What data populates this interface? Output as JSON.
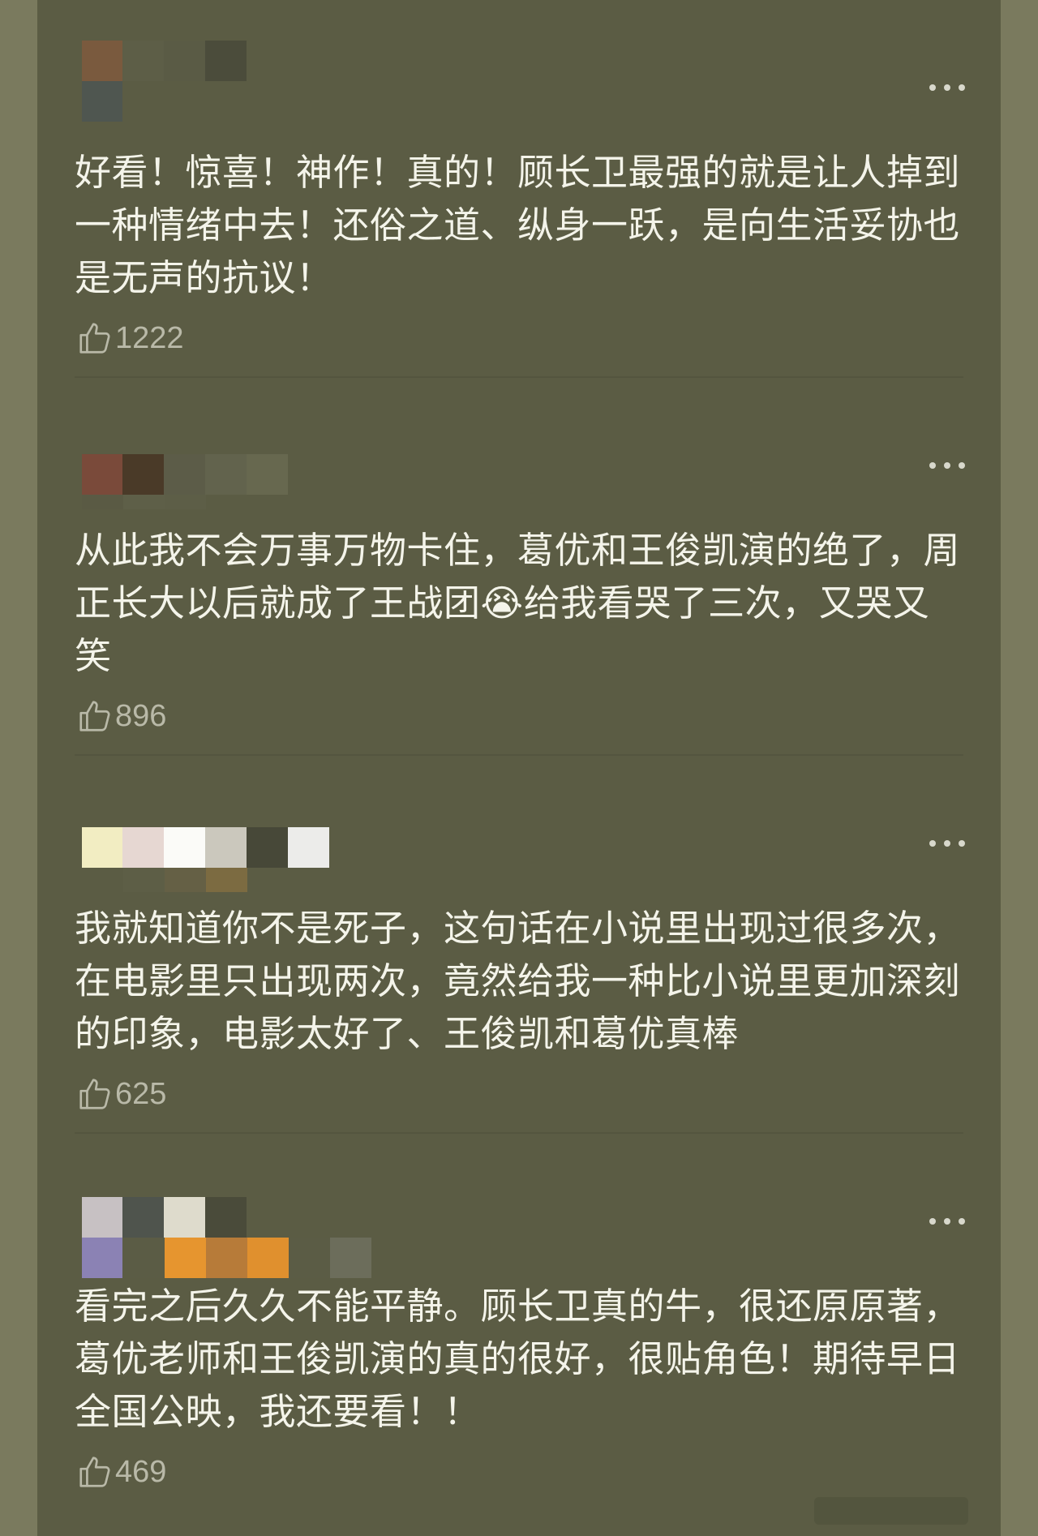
{
  "colors": {
    "background": "#7a7a5e",
    "panel": "#5b5c44",
    "text": "#f4f4ea",
    "like_count": "#b9b9a8"
  },
  "icons": {
    "like": "thumbs-up-icon",
    "more": "more-dots-icon"
  },
  "comments": [
    {
      "text": "好看！惊喜！神作！真的！顾长卫最强的就是让人掉到一种情绪中去！还俗之道、纵身一跃，是向生活妥协也是无声的抗议！",
      "likes": "1222"
    },
    {
      "text": "从此我不会万事万物卡住，葛优和王俊凯演的绝了，周正长大以后就成了王战团😭给我看哭了三次，又哭又笑",
      "likes": "896"
    },
    {
      "text": "我就知道你不是死子，这句话在小说里出现过很多次，在电影里只出现两次，竟然给我一种比小说里更加深刻的印象，电影太好了、王俊凯和葛优真棒",
      "likes": "625"
    },
    {
      "text": "看完之后久久不能平静。顾长卫真的牛，很还原原著，葛优老师和王俊凯演的真的很好，很贴角色！期待早日全国公映，我还要看！！",
      "likes": "469"
    }
  ]
}
